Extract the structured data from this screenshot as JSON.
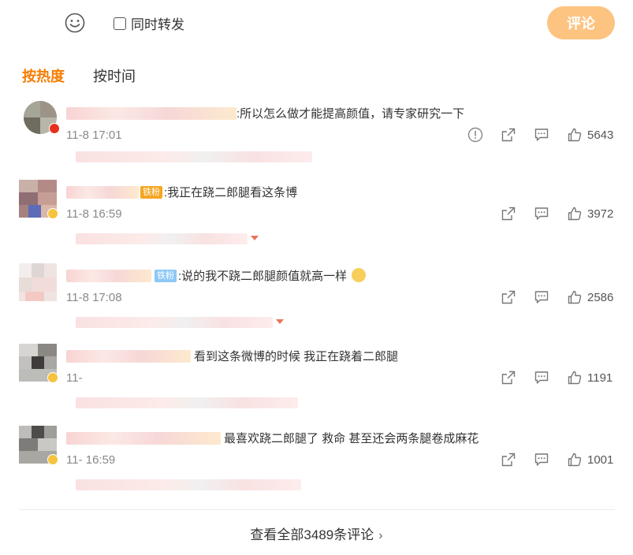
{
  "toolbar": {
    "emoji_icon": "smiley-icon",
    "repost_label": "同时转发",
    "submit_label": "评论"
  },
  "sort_tabs": [
    {
      "label": "按热度",
      "active": true
    },
    {
      "label": "按时间",
      "active": false
    }
  ],
  "comments": [
    {
      "content": ":所以怎么做才能提高颜值，请专家研究一下",
      "time": "11-8 17:01",
      "likes": "5643",
      "has_report": true
    },
    {
      "fan_badge": "铁粉",
      "content": ":我正在跷二郎腿看这条博",
      "time": "11-8 16:59",
      "likes": "3972",
      "has_report": false
    },
    {
      "fan_badge": "铁粉",
      "content": ":说的我不跷二郎腿颜值就高一样",
      "time": "11-8 17:08",
      "likes": "2586",
      "has_report": false
    },
    {
      "content": "看到这条微博的时候 我正在跷着二郎腿",
      "time": "11-",
      "likes": "1191",
      "has_report": false
    },
    {
      "content": "最喜欢跷二郎腿了 救命 甚至还会两条腿卷成麻花",
      "time": "11-    16:59",
      "likes": "1001",
      "has_report": false
    }
  ],
  "footer": {
    "view_all_label": "查看全部3489条评论"
  },
  "colors": {
    "accent": "#f77c00",
    "submit_bg": "#fdc380",
    "reply_arrow": "#e8755a"
  }
}
